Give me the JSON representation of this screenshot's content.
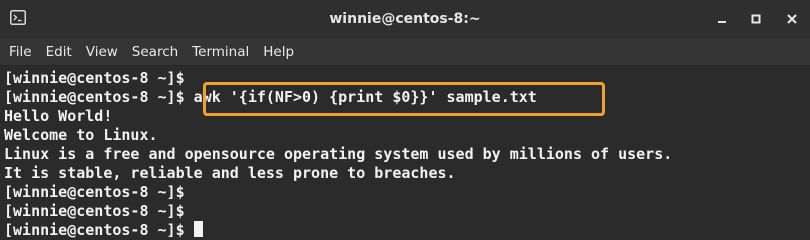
{
  "window": {
    "title": "winnie@centos-8:~",
    "icon": "terminal-icon",
    "controls": [
      "minimize-icon",
      "maximize-icon",
      "close-icon"
    ]
  },
  "menu": [
    {
      "label": "File"
    },
    {
      "label": "Edit"
    },
    {
      "label": "View"
    },
    {
      "label": "Search"
    },
    {
      "label": "Terminal"
    },
    {
      "label": "Help"
    }
  ],
  "terminal": {
    "prompt": "[winnie@centos-8 ~]$",
    "command": "awk '{if(NF>0) {print $0}}' sample.txt",
    "lines": [
      {
        "prompt": "[winnie@centos-8 ~]$",
        "text": ""
      },
      {
        "prompt": "[winnie@centos-8 ~]$",
        "text": " awk '{if(NF>0) {print $0}}' sample.txt"
      },
      {
        "prompt": "",
        "text": "Hello World!"
      },
      {
        "prompt": "",
        "text": "Welcome to Linux."
      },
      {
        "prompt": "",
        "text": "Linux is a free and opensource operating system used by millions of users."
      },
      {
        "prompt": "",
        "text": "It is stable, reliable and less prone to breaches."
      },
      {
        "prompt": "[winnie@centos-8 ~]$",
        "text": ""
      },
      {
        "prompt": "[winnie@centos-8 ~]$",
        "text": ""
      },
      {
        "prompt": "[winnie@centos-8 ~]$",
        "text": " "
      }
    ],
    "highlight_color": "#f0a22e",
    "fg_color": "#f2f2f2",
    "bg_color": "#2b2b2b"
  }
}
